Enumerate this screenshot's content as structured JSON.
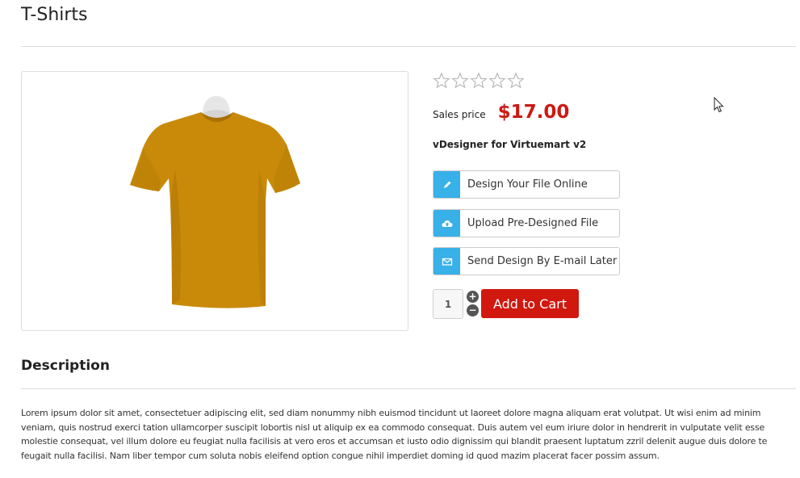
{
  "page": {
    "title": "T-Shirts"
  },
  "product": {
    "image_alt": "T-shirt",
    "rating": {
      "value": 0,
      "max": 5
    },
    "price_label": "Sales price",
    "price_value": "$17.00",
    "name": "vDesigner for Virtuemart v2"
  },
  "design_options": [
    {
      "label": "Design Your File Online",
      "icon": "pencil-icon"
    },
    {
      "label": "Upload Pre-Designed File",
      "icon": "cloud-upload-icon"
    },
    {
      "label": "Send Design By E-mail Later",
      "icon": "envelope-icon"
    }
  ],
  "cart": {
    "quantity": "1",
    "plus_label": "+",
    "minus_label": "−",
    "add_to_cart_label": "Add to Cart"
  },
  "description": {
    "title": "Description",
    "text": "Lorem ipsum dolor sit amet, consectetuer adipiscing elit, sed diam nonummy nibh euismod tincidunt ut laoreet dolore magna aliquam erat volutpat. Ut wisi enim ad minim veniam, quis nostrud exerci tation ullamcorper suscipit lobortis nisl ut aliquip ex ea commodo consequat. Duis autem vel eum iriure dolor in hendrerit in vulputate velit esse molestie consequat, vel illum dolore eu feugiat nulla facilisis at vero eros et accumsan et iusto odio dignissim qui blandit praesent luptatum zzril delenit augue duis dolore te feugait nulla facilisi. Nam liber tempor cum soluta nobis eleifend option congue nihil imperdiet doming id quod mazim placerat facer possim assum."
  },
  "colors": {
    "accent_blue": "#38b0e8",
    "price_red": "#cc1a14",
    "cart_red": "#d0180f",
    "shirt": "#c98a0a"
  }
}
